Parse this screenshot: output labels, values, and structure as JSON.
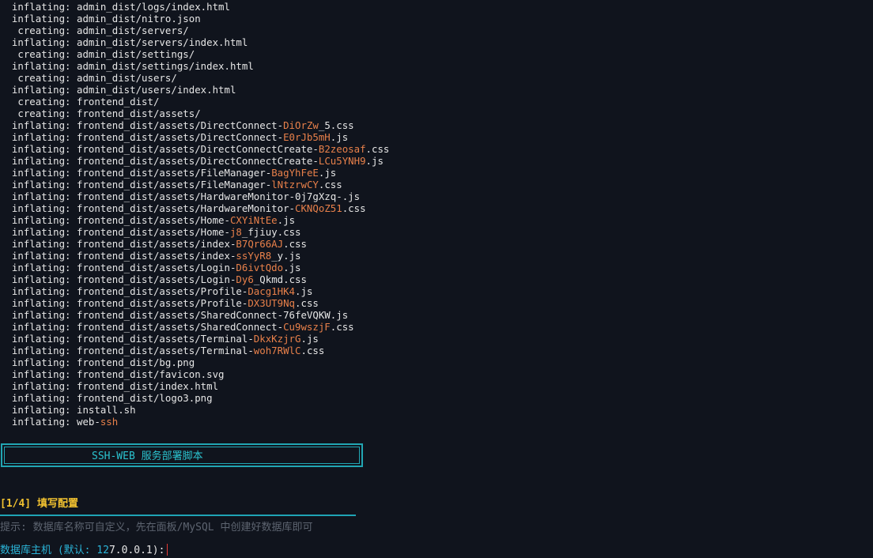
{
  "log_lines": [
    {
      "action": "inflating:",
      "path": "admin_dist/logs/index.html",
      "hash": "",
      "ext": ""
    },
    {
      "action": "inflating:",
      "path": "admin_dist/nitro.json",
      "hash": "",
      "ext": ""
    },
    {
      "action": " creating:",
      "path": "admin_dist/servers/",
      "hash": "",
      "ext": ""
    },
    {
      "action": "inflating:",
      "path": "admin_dist/servers/index.html",
      "hash": "",
      "ext": ""
    },
    {
      "action": " creating:",
      "path": "admin_dist/settings/",
      "hash": "",
      "ext": ""
    },
    {
      "action": "inflating:",
      "path": "admin_dist/settings/index.html",
      "hash": "",
      "ext": ""
    },
    {
      "action": " creating:",
      "path": "admin_dist/users/",
      "hash": "",
      "ext": ""
    },
    {
      "action": "inflating:",
      "path": "admin_dist/users/index.html",
      "hash": "",
      "ext": ""
    },
    {
      "action": " creating:",
      "path": "frontend_dist/",
      "hash": "",
      "ext": ""
    },
    {
      "action": " creating:",
      "path": "frontend_dist/assets/",
      "hash": "",
      "ext": ""
    },
    {
      "action": "inflating:",
      "path": "frontend_dist/assets/DirectConnect-",
      "hash": "DiOrZw",
      "ext": "_5.css"
    },
    {
      "action": "inflating:",
      "path": "frontend_dist/assets/DirectConnect-",
      "hash": "E0rJb5mH",
      "ext": ".js"
    },
    {
      "action": "inflating:",
      "path": "frontend_dist/assets/DirectConnectCreate-",
      "hash": "B2zeosaf",
      "ext": ".css"
    },
    {
      "action": "inflating:",
      "path": "frontend_dist/assets/DirectConnectCreate-",
      "hash": "LCu5YNH9",
      "ext": ".js"
    },
    {
      "action": "inflating:",
      "path": "frontend_dist/assets/FileManager-",
      "hash": "BagYhFeE",
      "ext": ".js"
    },
    {
      "action": "inflating:",
      "path": "frontend_dist/assets/FileManager-",
      "hash": "lNtzrwCY",
      "ext": ".css"
    },
    {
      "action": "inflating:",
      "path": "frontend_dist/assets/HardwareMonitor-0j7gXzq-.js",
      "hash": "",
      "ext": ""
    },
    {
      "action": "inflating:",
      "path": "frontend_dist/assets/HardwareMonitor-",
      "hash": "CKNQoZ51",
      "ext": ".css"
    },
    {
      "action": "inflating:",
      "path": "frontend_dist/assets/Home-",
      "hash": "CXYiNtEe",
      "ext": ".js"
    },
    {
      "action": "inflating:",
      "path": "frontend_dist/assets/Home-",
      "hash": "j8",
      "ext": "_fjiuy.css"
    },
    {
      "action": "inflating:",
      "path": "frontend_dist/assets/index-",
      "hash": "B7Qr66AJ",
      "ext": ".css"
    },
    {
      "action": "inflating:",
      "path": "frontend_dist/assets/index-",
      "hash": "ssYyR8",
      "ext": "_y.js"
    },
    {
      "action": "inflating:",
      "path": "frontend_dist/assets/Login-",
      "hash": "D6ivtQdo",
      "ext": ".js"
    },
    {
      "action": "inflating:",
      "path": "frontend_dist/assets/Login-",
      "hash": "Dy6",
      "ext": "_Qkmd.css"
    },
    {
      "action": "inflating:",
      "path": "frontend_dist/assets/Profile-",
      "hash": "Dacg1HK4",
      "ext": ".js"
    },
    {
      "action": "inflating:",
      "path": "frontend_dist/assets/Profile-",
      "hash": "DX3UT9Nq",
      "ext": ".css"
    },
    {
      "action": "inflating:",
      "path": "frontend_dist/assets/SharedConnect-76feVQKW.js",
      "hash": "",
      "ext": ""
    },
    {
      "action": "inflating:",
      "path": "frontend_dist/assets/SharedConnect-",
      "hash": "Cu9wszjF",
      "ext": ".css"
    },
    {
      "action": "inflating:",
      "path": "frontend_dist/assets/Terminal-",
      "hash": "DkxKzjrG",
      "ext": ".js"
    },
    {
      "action": "inflating:",
      "path": "frontend_dist/assets/Terminal-",
      "hash": "woh7RWlC",
      "ext": ".css"
    },
    {
      "action": "inflating:",
      "path": "frontend_dist/bg.png",
      "hash": "",
      "ext": ""
    },
    {
      "action": "inflating:",
      "path": "frontend_dist/favicon.svg",
      "hash": "",
      "ext": ""
    },
    {
      "action": "inflating:",
      "path": "frontend_dist/index.html",
      "hash": "",
      "ext": ""
    },
    {
      "action": "inflating:",
      "path": "frontend_dist/logo3.png",
      "hash": "",
      "ext": ""
    },
    {
      "action": "inflating:",
      "path": "install.sh",
      "hash": "",
      "ext": ""
    },
    {
      "action": "inflating:",
      "path": "web-",
      "hash": "ssh",
      "ext": ""
    }
  ],
  "banner": {
    "title": "SSH-WEB 服务部署脚本"
  },
  "step": {
    "number": "[1/4]",
    "title": "填写配置"
  },
  "hint": "提示: 数据库名称可自定义，先在面板/MySQL 中创建好数据库即可",
  "prompt": {
    "label": "数据库主机 (默认: 12",
    "value": "7.0.0.1):"
  },
  "colors": {
    "background": "#10141d",
    "hash_highlight": "#e8804a",
    "banner_accent": "#22a6b3",
    "step_accent": "#f2c230",
    "prompt_accent": "#2bb4d8",
    "hint": "#5d6470",
    "cursor": "#e53935"
  }
}
